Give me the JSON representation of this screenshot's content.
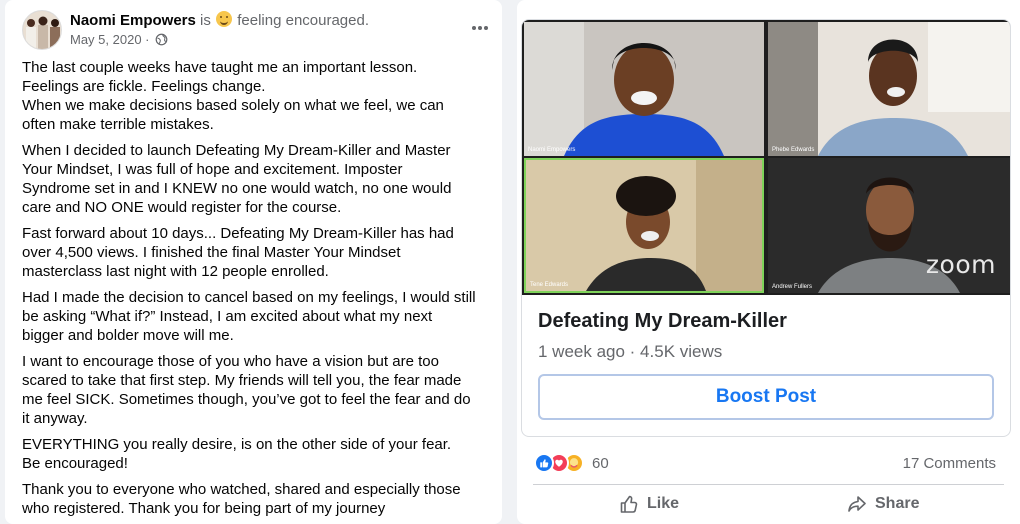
{
  "post": {
    "author": "Naomi Empowers",
    "is_text": "is",
    "feeling": "feeling encouraged.",
    "date": "May 5, 2020",
    "separator": "·",
    "paragraphs": [
      [
        "The last couple weeks have taught me an important lesson.",
        "Feelings are fickle. Feelings change.",
        "When we make decisions based solely on what we feel, we can",
        "often make terrible mistakes."
      ],
      [
        "When I decided to launch Defeating My Dream-Killer and Master",
        "Your Mindset, I was full of hope and excitement.  Imposter",
        "Syndrome set in and I KNEW no one would watch, no one would",
        "care and NO ONE would register for the course."
      ],
      [
        "Fast forward about 10 days... Defeating My Dream-Killer has had",
        "over 4,500 views.  I finished the final Master Your Mindset",
        "masterclass last night with 12 people enrolled."
      ],
      [
        "Had I made the decision to cancel based on my feelings, I would still",
        "be asking “What if?” Instead, I am excited about what my next",
        "bigger and bolder move will me."
      ],
      [
        "I want to encourage those of you who have a vision but are too",
        "scared to take that first step.  My friends will tell you, the fear made",
        "me feel SICK. Sometimes though, you’ve got to feel the fear and do",
        "it anyway."
      ],
      [
        "EVERYTHING you really desire, is on the other side of your fear.",
        "Be encouraged!"
      ],
      [
        "Thank you to everyone who watched, shared and especially those",
        "who registered.  Thank you for being part of my journey"
      ]
    ]
  },
  "video": {
    "participants": [
      "Naomi Empowers",
      "Phebe Edwards",
      "Tene Edwards",
      "Andrew Fullers"
    ],
    "watermark": "zoom",
    "title": "Defeating My Dream-Killer",
    "meta": "1 week ago · 4.5K views",
    "boost_label": "Boost Post"
  },
  "engagement": {
    "reaction_count": "60",
    "comments": "17 Comments",
    "like_label": "Like",
    "share_label": "Share"
  },
  "icons": {
    "more": "more-options-icon",
    "privacy": "globe-icon",
    "like": "thumbs-up-icon",
    "share": "share-arrow-icon"
  },
  "colors": {
    "accent": "#1877f2",
    "secondary_text": "#65676b",
    "active_speaker": "#7fd35a"
  }
}
